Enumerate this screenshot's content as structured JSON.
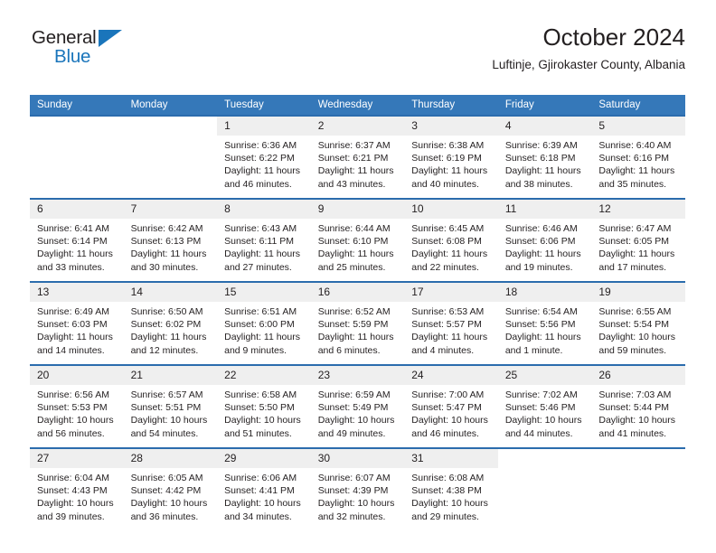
{
  "brand": {
    "name_top": "General",
    "name_bottom": "Blue",
    "accent_color": "#1a75bb"
  },
  "header": {
    "title": "October 2024",
    "location": "Luftinje, Gjirokaster County, Albania"
  },
  "colors": {
    "header_blue": "#3578b9",
    "row_divider_blue": "#2b6cad",
    "daynum_band": "#efefef",
    "text": "#231f20"
  },
  "weekday_headers": [
    "Sunday",
    "Monday",
    "Tuesday",
    "Wednesday",
    "Thursday",
    "Friday",
    "Saturday"
  ],
  "weeks": [
    [
      {
        "day": "",
        "sunrise": "",
        "sunset": "",
        "daylight": "",
        "empty": true
      },
      {
        "day": "",
        "sunrise": "",
        "sunset": "",
        "daylight": "",
        "empty": true
      },
      {
        "day": "1",
        "sunrise": "Sunrise: 6:36 AM",
        "sunset": "Sunset: 6:22 PM",
        "daylight": "Daylight: 11 hours and 46 minutes."
      },
      {
        "day": "2",
        "sunrise": "Sunrise: 6:37 AM",
        "sunset": "Sunset: 6:21 PM",
        "daylight": "Daylight: 11 hours and 43 minutes."
      },
      {
        "day": "3",
        "sunrise": "Sunrise: 6:38 AM",
        "sunset": "Sunset: 6:19 PM",
        "daylight": "Daylight: 11 hours and 40 minutes."
      },
      {
        "day": "4",
        "sunrise": "Sunrise: 6:39 AM",
        "sunset": "Sunset: 6:18 PM",
        "daylight": "Daylight: 11 hours and 38 minutes."
      },
      {
        "day": "5",
        "sunrise": "Sunrise: 6:40 AM",
        "sunset": "Sunset: 6:16 PM",
        "daylight": "Daylight: 11 hours and 35 minutes."
      }
    ],
    [
      {
        "day": "6",
        "sunrise": "Sunrise: 6:41 AM",
        "sunset": "Sunset: 6:14 PM",
        "daylight": "Daylight: 11 hours and 33 minutes."
      },
      {
        "day": "7",
        "sunrise": "Sunrise: 6:42 AM",
        "sunset": "Sunset: 6:13 PM",
        "daylight": "Daylight: 11 hours and 30 minutes."
      },
      {
        "day": "8",
        "sunrise": "Sunrise: 6:43 AM",
        "sunset": "Sunset: 6:11 PM",
        "daylight": "Daylight: 11 hours and 27 minutes."
      },
      {
        "day": "9",
        "sunrise": "Sunrise: 6:44 AM",
        "sunset": "Sunset: 6:10 PM",
        "daylight": "Daylight: 11 hours and 25 minutes."
      },
      {
        "day": "10",
        "sunrise": "Sunrise: 6:45 AM",
        "sunset": "Sunset: 6:08 PM",
        "daylight": "Daylight: 11 hours and 22 minutes."
      },
      {
        "day": "11",
        "sunrise": "Sunrise: 6:46 AM",
        "sunset": "Sunset: 6:06 PM",
        "daylight": "Daylight: 11 hours and 19 minutes."
      },
      {
        "day": "12",
        "sunrise": "Sunrise: 6:47 AM",
        "sunset": "Sunset: 6:05 PM",
        "daylight": "Daylight: 11 hours and 17 minutes."
      }
    ],
    [
      {
        "day": "13",
        "sunrise": "Sunrise: 6:49 AM",
        "sunset": "Sunset: 6:03 PM",
        "daylight": "Daylight: 11 hours and 14 minutes."
      },
      {
        "day": "14",
        "sunrise": "Sunrise: 6:50 AM",
        "sunset": "Sunset: 6:02 PM",
        "daylight": "Daylight: 11 hours and 12 minutes."
      },
      {
        "day": "15",
        "sunrise": "Sunrise: 6:51 AM",
        "sunset": "Sunset: 6:00 PM",
        "daylight": "Daylight: 11 hours and 9 minutes."
      },
      {
        "day": "16",
        "sunrise": "Sunrise: 6:52 AM",
        "sunset": "Sunset: 5:59 PM",
        "daylight": "Daylight: 11 hours and 6 minutes."
      },
      {
        "day": "17",
        "sunrise": "Sunrise: 6:53 AM",
        "sunset": "Sunset: 5:57 PM",
        "daylight": "Daylight: 11 hours and 4 minutes."
      },
      {
        "day": "18",
        "sunrise": "Sunrise: 6:54 AM",
        "sunset": "Sunset: 5:56 PM",
        "daylight": "Daylight: 11 hours and 1 minute."
      },
      {
        "day": "19",
        "sunrise": "Sunrise: 6:55 AM",
        "sunset": "Sunset: 5:54 PM",
        "daylight": "Daylight: 10 hours and 59 minutes."
      }
    ],
    [
      {
        "day": "20",
        "sunrise": "Sunrise: 6:56 AM",
        "sunset": "Sunset: 5:53 PM",
        "daylight": "Daylight: 10 hours and 56 minutes."
      },
      {
        "day": "21",
        "sunrise": "Sunrise: 6:57 AM",
        "sunset": "Sunset: 5:51 PM",
        "daylight": "Daylight: 10 hours and 54 minutes."
      },
      {
        "day": "22",
        "sunrise": "Sunrise: 6:58 AM",
        "sunset": "Sunset: 5:50 PM",
        "daylight": "Daylight: 10 hours and 51 minutes."
      },
      {
        "day": "23",
        "sunrise": "Sunrise: 6:59 AM",
        "sunset": "Sunset: 5:49 PM",
        "daylight": "Daylight: 10 hours and 49 minutes."
      },
      {
        "day": "24",
        "sunrise": "Sunrise: 7:00 AM",
        "sunset": "Sunset: 5:47 PM",
        "daylight": "Daylight: 10 hours and 46 minutes."
      },
      {
        "day": "25",
        "sunrise": "Sunrise: 7:02 AM",
        "sunset": "Sunset: 5:46 PM",
        "daylight": "Daylight: 10 hours and 44 minutes."
      },
      {
        "day": "26",
        "sunrise": "Sunrise: 7:03 AM",
        "sunset": "Sunset: 5:44 PM",
        "daylight": "Daylight: 10 hours and 41 minutes."
      }
    ],
    [
      {
        "day": "27",
        "sunrise": "Sunrise: 6:04 AM",
        "sunset": "Sunset: 4:43 PM",
        "daylight": "Daylight: 10 hours and 39 minutes."
      },
      {
        "day": "28",
        "sunrise": "Sunrise: 6:05 AM",
        "sunset": "Sunset: 4:42 PM",
        "daylight": "Daylight: 10 hours and 36 minutes."
      },
      {
        "day": "29",
        "sunrise": "Sunrise: 6:06 AM",
        "sunset": "Sunset: 4:41 PM",
        "daylight": "Daylight: 10 hours and 34 minutes."
      },
      {
        "day": "30",
        "sunrise": "Sunrise: 6:07 AM",
        "sunset": "Sunset: 4:39 PM",
        "daylight": "Daylight: 10 hours and 32 minutes."
      },
      {
        "day": "31",
        "sunrise": "Sunrise: 6:08 AM",
        "sunset": "Sunset: 4:38 PM",
        "daylight": "Daylight: 10 hours and 29 minutes."
      },
      {
        "day": "",
        "sunrise": "",
        "sunset": "",
        "daylight": "",
        "empty": true
      },
      {
        "day": "",
        "sunrise": "",
        "sunset": "",
        "daylight": "",
        "empty": true
      }
    ]
  ]
}
